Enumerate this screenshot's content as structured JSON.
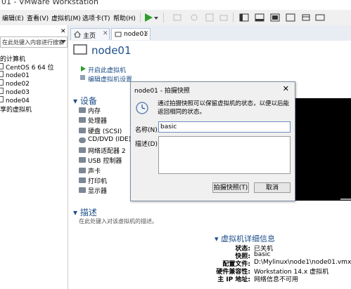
{
  "window": {
    "title": "01 - VMware Workstation"
  },
  "menu": [
    "编辑(E)",
    "查看(V)",
    "虚拟机(M)",
    "选项卡(T)",
    "帮助(H)"
  ],
  "search": {
    "placeholder": "在此处键入内容进行搜索"
  },
  "tree": {
    "root": "的计算机",
    "items": [
      "CentOS 6 64 位",
      "node01",
      "node02",
      "node03",
      "node04",
      "享的虚拟机"
    ]
  },
  "tabs": [
    {
      "label": "主页"
    },
    {
      "label": "node01"
    }
  ],
  "vm": {
    "name": "node01",
    "actions": [
      "开启此虚拟机",
      "编辑虚拟机设置"
    ],
    "devices_title": "设备",
    "devices": [
      "内存",
      "处理器",
      "硬盘 (SCSI)",
      "CD/DVD (IDE)",
      "网络适配器 2",
      "USB 控制器",
      "声卡",
      "打印机",
      "显示器"
    ],
    "desc_title": "描述",
    "desc_placeholder": "在此处键入对该虚拟机的描述。",
    "details_title": "虚拟机详细信息",
    "details": [
      {
        "k": "状态:",
        "v": "已关机"
      },
      {
        "k": "快照:",
        "v": "basic"
      },
      {
        "k": "配置文件:",
        "v": "D:\\Mylinux\\node1\\node01.vmx"
      },
      {
        "k": "硬件兼容性:",
        "v": "Workstation 14.x 虚拟机"
      },
      {
        "k": "主 IP 地址:",
        "v": "网络信息不可用"
      }
    ]
  },
  "dialog": {
    "title": "node01 - 拍摄快照",
    "info": "通过拍摄快照可以保留虚拟机的状态，以便以后能返回相同的状态。",
    "name_label": "名称(N):",
    "name_value": "basic",
    "desc_label": "描述(D):",
    "ok": "拍摄快照(T)",
    "cancel": "取消"
  },
  "colors": {
    "accent": "#1d4e89",
    "play": "#2e9e2e"
  }
}
